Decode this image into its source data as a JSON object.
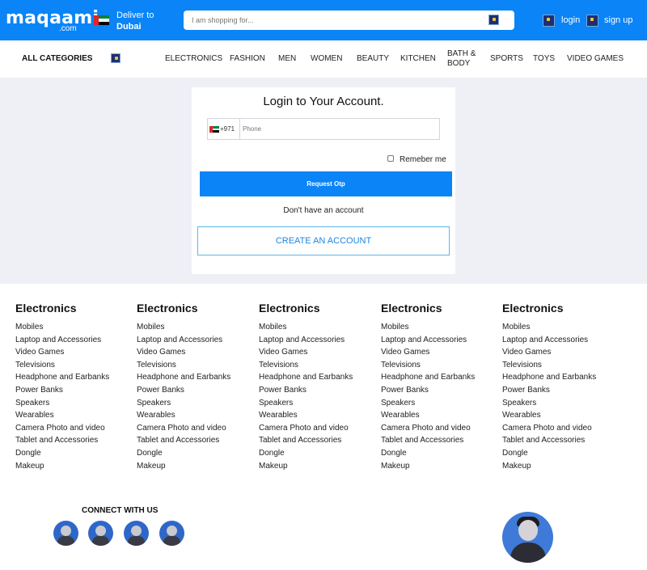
{
  "header": {
    "logo": "maqaami",
    "logo_sub": ".com",
    "deliver_label": "Deliver to",
    "deliver_city": "Dubai",
    "search_placeholder": "I am shopping for...",
    "login": "login",
    "signup": "sign up",
    "accent_color": "#0a84f7"
  },
  "nav": {
    "all_categories": "ALL CATEGORIES",
    "items": [
      "ELECTRONICS",
      "FASHION",
      "MEN",
      "WOMEN",
      "BEAUTY",
      "KITCHEN",
      "BATH & BODY",
      "SPORTS",
      "TOYS",
      "VIDEO GAMES"
    ]
  },
  "login": {
    "title": "Login to Your Account.",
    "dial_code": "+971",
    "phone_placeholder": "Phone",
    "remember_label": "Remeber me",
    "otp_button": "Request Otp",
    "no_account": "Don't have an account",
    "create_button": "CREATE AN ACCOUNT"
  },
  "footer": {
    "columns": [
      {
        "title": "Electronics",
        "links": [
          "Mobiles",
          "Laptop and Accessories",
          "Video Games",
          "Televisions",
          "Headphone and Earbanks",
          "Power Banks",
          "Speakers",
          "Wearables",
          "Camera Photo and video",
          "Tablet and Accessories",
          "Dongle",
          "Makeup"
        ]
      },
      {
        "title": "Electronics",
        "links": [
          "Mobiles",
          "Laptop and Accessories",
          "Video Games",
          "Televisions",
          "Headphone and Earbanks",
          "Power Banks",
          "Speakers",
          "Wearables",
          "Camera Photo and video",
          "Tablet and Accessories",
          "Dongle",
          "Makeup"
        ]
      },
      {
        "title": "Electronics",
        "links": [
          "Mobiles",
          "Laptop and Accessories",
          "Video Games",
          "Televisions",
          "Headphone and Earbanks",
          "Power Banks",
          "Speakers",
          "Wearables",
          "Camera Photo and video",
          "Tablet and Accessories",
          "Dongle",
          "Makeup"
        ]
      },
      {
        "title": "Electronics",
        "links": [
          "Mobiles",
          "Laptop and Accessories",
          "Video Games",
          "Televisions",
          "Headphone and Earbanks",
          "Power Banks",
          "Speakers",
          "Wearables",
          "Camera Photo and video",
          "Tablet and Accessories",
          "Dongle",
          "Makeup"
        ]
      },
      {
        "title": "Electronics",
        "links": [
          "Mobiles",
          "Laptop and Accessories",
          "Video Games",
          "Televisions",
          "Headphone and Earbanks",
          "Power Banks",
          "Speakers",
          "Wearables",
          "Camera Photo and video",
          "Tablet and Accessories",
          "Dongle",
          "Makeup"
        ]
      }
    ],
    "connect_title": "CONNECT WITH US"
  }
}
